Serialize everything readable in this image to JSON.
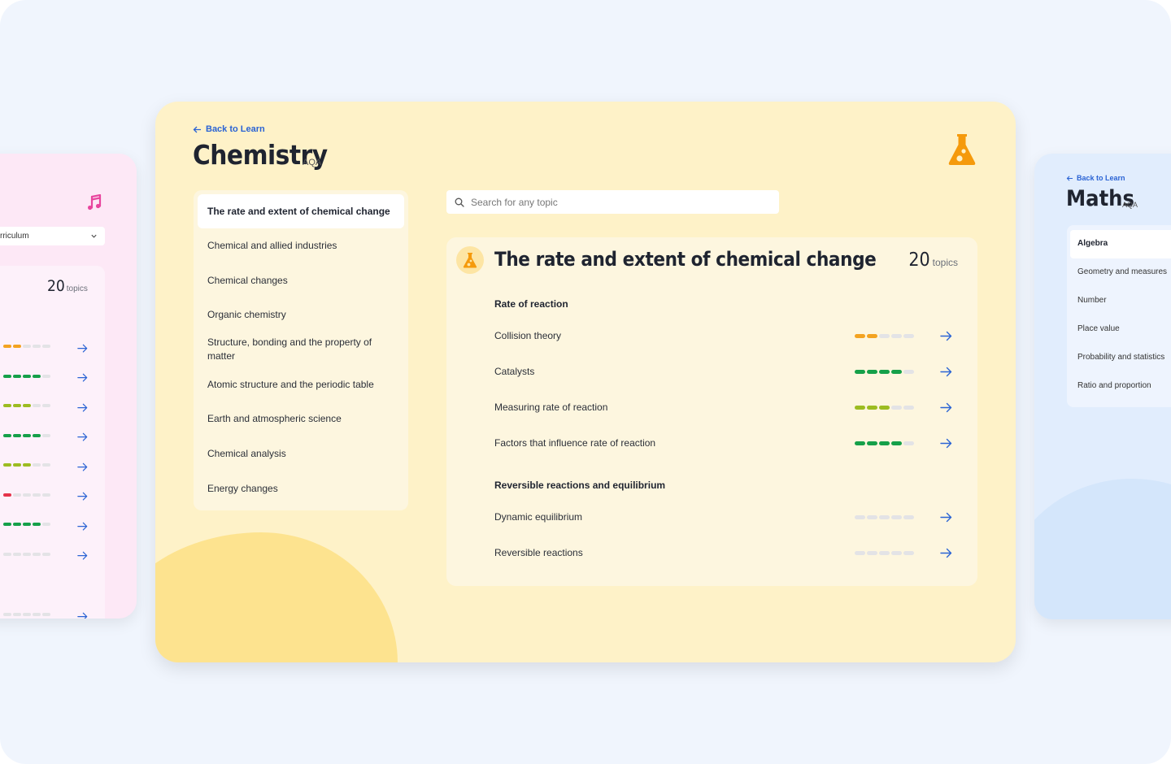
{
  "colors": {
    "accent_blue": "#2a63d4",
    "orange": "#f3a321",
    "green": "#15a049",
    "lime": "#9cbc21",
    "red": "#e5334a",
    "empty": "#e3e3e6",
    "flask": "#f59a0c",
    "music": "#e8459e"
  },
  "left_card": {
    "icon": "music-note-icon",
    "dropdown_value": "rriculum",
    "topics_count": "20",
    "topics_label": "topics",
    "rows": [
      {
        "levels": [
          1,
          1,
          0,
          0,
          0
        ],
        "color": "orange"
      },
      {
        "levels": [
          1,
          1,
          1,
          1,
          0
        ],
        "color": "green"
      },
      {
        "levels": [
          1,
          1,
          1,
          0,
          0
        ],
        "color": "lime"
      },
      {
        "levels": [
          1,
          1,
          1,
          1,
          0
        ],
        "color": "green"
      },
      {
        "levels": [
          1,
          1,
          1,
          0,
          0
        ],
        "color": "lime"
      },
      {
        "levels": [
          1,
          0,
          0,
          0,
          0
        ],
        "color": "red"
      },
      {
        "levels": [
          1,
          1,
          1,
          1,
          0
        ],
        "color": "green"
      },
      {
        "levels": [
          0,
          0,
          0,
          0,
          0
        ],
        "color": "empty"
      },
      {
        "levels": [
          0,
          0,
          0,
          0,
          0
        ],
        "color": "empty"
      }
    ]
  },
  "main": {
    "back_label": "Back to Learn",
    "title": "Chemistry",
    "board": "AQA",
    "search_placeholder": "Search for any topic",
    "topics": [
      "The rate and extent of chemical change",
      "Chemical and allied industries",
      "Chemical changes",
      "Organic chemistry",
      "Structure, bonding and the property of matter",
      "Atomic structure and the periodic table",
      "Earth and atmospheric science",
      "Chemical analysis",
      "Energy changes"
    ],
    "active_topic": 0,
    "panel": {
      "title": "The rate and extent of chemical change",
      "count": "20",
      "count_label": "topics",
      "sections": [
        {
          "heading": "Rate of reaction",
          "rows": [
            {
              "label": "Collision theory",
              "filled": 2,
              "color": "orange"
            },
            {
              "label": "Catalysts",
              "filled": 4,
              "color": "green"
            },
            {
              "label": "Measuring rate of reaction",
              "filled": 3,
              "color": "lime"
            },
            {
              "label": "Factors that influence rate of reaction",
              "filled": 4,
              "color": "green"
            }
          ]
        },
        {
          "heading": "Reversible reactions and equilibrium",
          "rows": [
            {
              "label": "Dynamic equilibrium",
              "filled": 0,
              "color": "empty"
            },
            {
              "label": "Reversible reactions",
              "filled": 0,
              "color": "empty"
            }
          ]
        }
      ]
    }
  },
  "right_card": {
    "back_label": "Back to Learn",
    "title": "Maths",
    "board": "AQA",
    "topics": [
      "Algebra",
      "Geometry and measures",
      "Number",
      "Place value",
      "Probability and statistics",
      "Ratio and proportion"
    ],
    "active_topic": 0
  }
}
